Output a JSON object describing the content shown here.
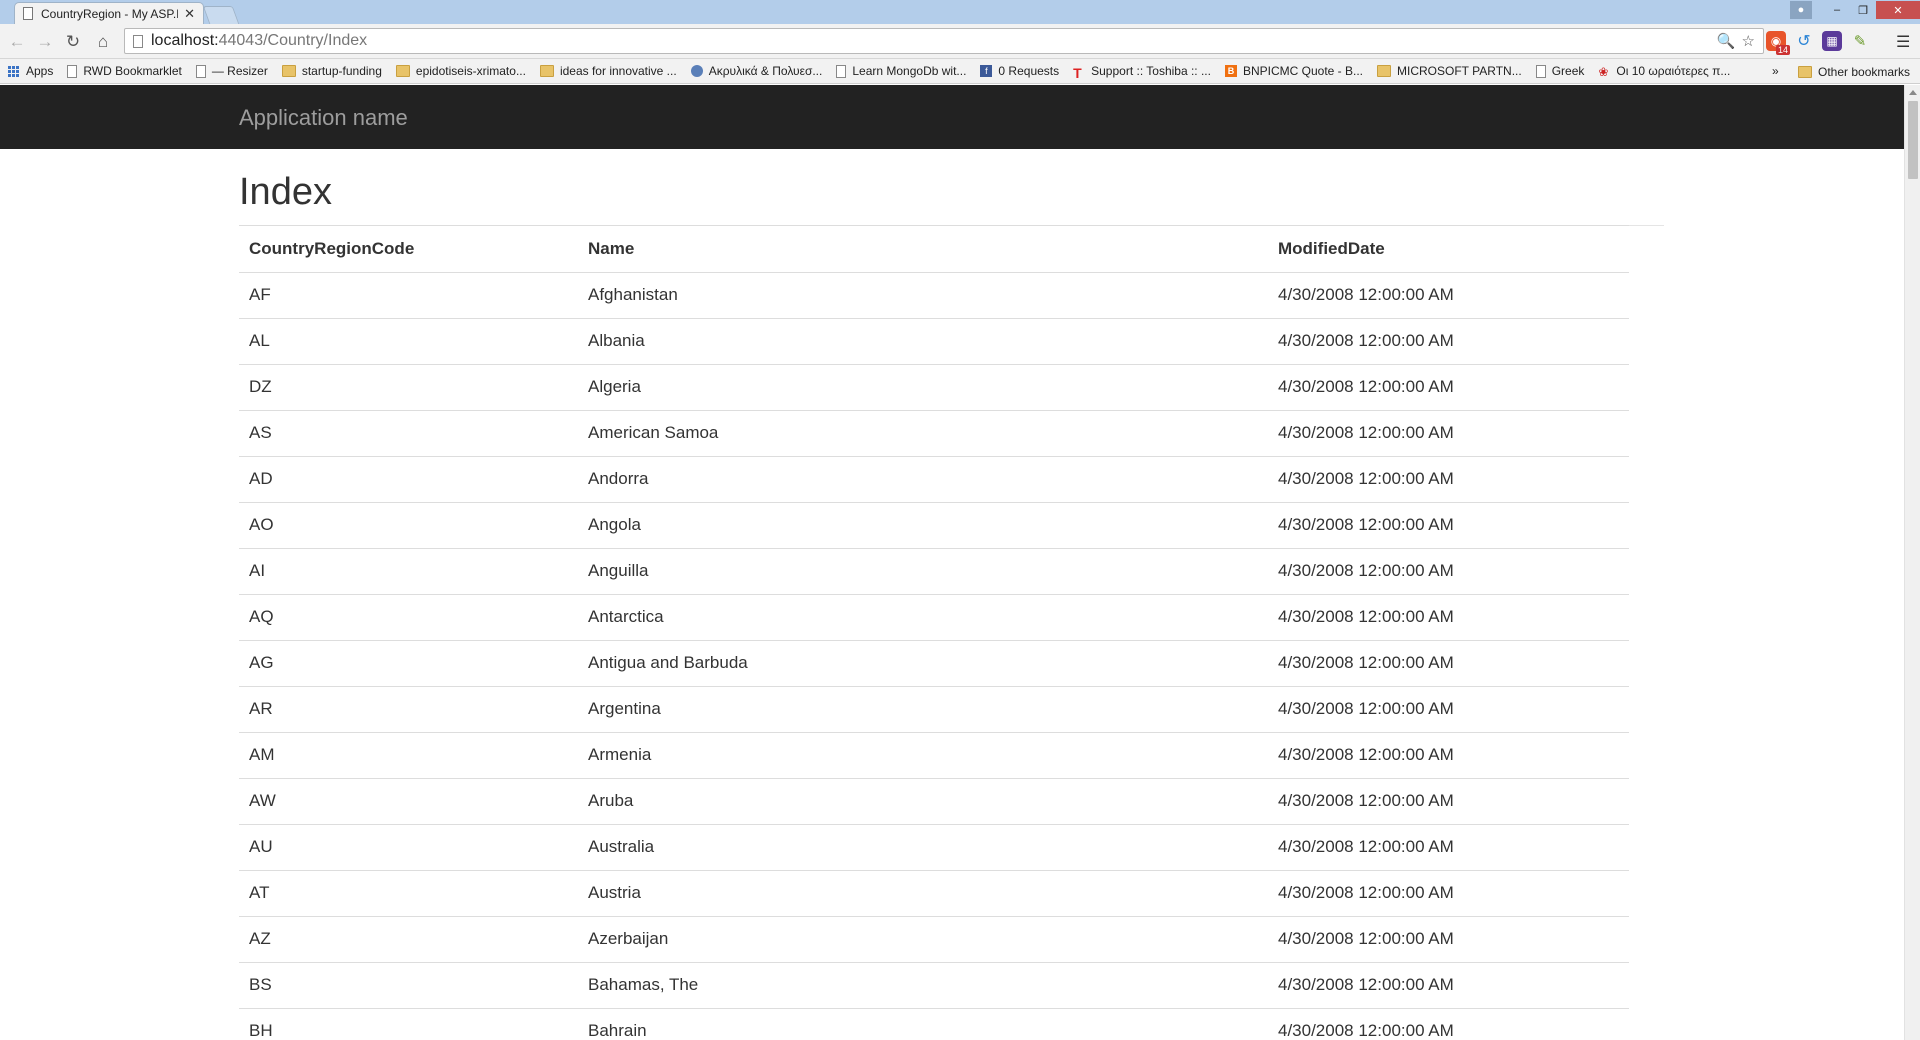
{
  "browser": {
    "tab_title": "CountryRegion - My ASP.I",
    "tab_close": "✕",
    "url_host": "localhost:",
    "url_path": "44043/Country/Index",
    "extension_badge": "14",
    "bookmarks": [
      {
        "icon": "apps",
        "label": "Apps"
      },
      {
        "icon": "page",
        "label": "RWD Bookmarklet"
      },
      {
        "icon": "page",
        "label": "— Resizer"
      },
      {
        "icon": "folder",
        "label": "startup-funding"
      },
      {
        "icon": "folder",
        "label": "epidotiseis-xrimato..."
      },
      {
        "icon": "folder",
        "label": "ideas for innovative ..."
      },
      {
        "icon": "globe",
        "label": "Ακρυλικά & Πολυεσ..."
      },
      {
        "icon": "page",
        "label": "Learn MongoDb wit..."
      },
      {
        "icon": "fb",
        "label": "0 Requests"
      },
      {
        "icon": "t",
        "label": "Support :: Toshiba :: ..."
      },
      {
        "icon": "b",
        "label": "BNPICMC Quote - B..."
      },
      {
        "icon": "folder",
        "label": "MICROSOFT PARTN..."
      },
      {
        "icon": "page",
        "label": "Greek"
      },
      {
        "icon": "rose",
        "label": "Οι 10 ωραιότερες π..."
      }
    ],
    "bookmarks_more": "»",
    "other_bookmarks": "Other bookmarks"
  },
  "app": {
    "brand": "Application name",
    "page_title": "Index"
  },
  "table": {
    "headers": [
      "CountryRegionCode",
      "Name",
      "ModifiedDate"
    ],
    "rows": [
      [
        "AF",
        "Afghanistan",
        "4/30/2008 12:00:00 AM"
      ],
      [
        "AL",
        "Albania",
        "4/30/2008 12:00:00 AM"
      ],
      [
        "DZ",
        "Algeria",
        "4/30/2008 12:00:00 AM"
      ],
      [
        "AS",
        "American Samoa",
        "4/30/2008 12:00:00 AM"
      ],
      [
        "AD",
        "Andorra",
        "4/30/2008 12:00:00 AM"
      ],
      [
        "AO",
        "Angola",
        "4/30/2008 12:00:00 AM"
      ],
      [
        "AI",
        "Anguilla",
        "4/30/2008 12:00:00 AM"
      ],
      [
        "AQ",
        "Antarctica",
        "4/30/2008 12:00:00 AM"
      ],
      [
        "AG",
        "Antigua and Barbuda",
        "4/30/2008 12:00:00 AM"
      ],
      [
        "AR",
        "Argentina",
        "4/30/2008 12:00:00 AM"
      ],
      [
        "AM",
        "Armenia",
        "4/30/2008 12:00:00 AM"
      ],
      [
        "AW",
        "Aruba",
        "4/30/2008 12:00:00 AM"
      ],
      [
        "AU",
        "Australia",
        "4/30/2008 12:00:00 AM"
      ],
      [
        "AT",
        "Austria",
        "4/30/2008 12:00:00 AM"
      ],
      [
        "AZ",
        "Azerbaijan",
        "4/30/2008 12:00:00 AM"
      ],
      [
        "BS",
        "Bahamas, The",
        "4/30/2008 12:00:00 AM"
      ],
      [
        "BH",
        "Bahrain",
        "4/30/2008 12:00:00 AM"
      ]
    ]
  }
}
